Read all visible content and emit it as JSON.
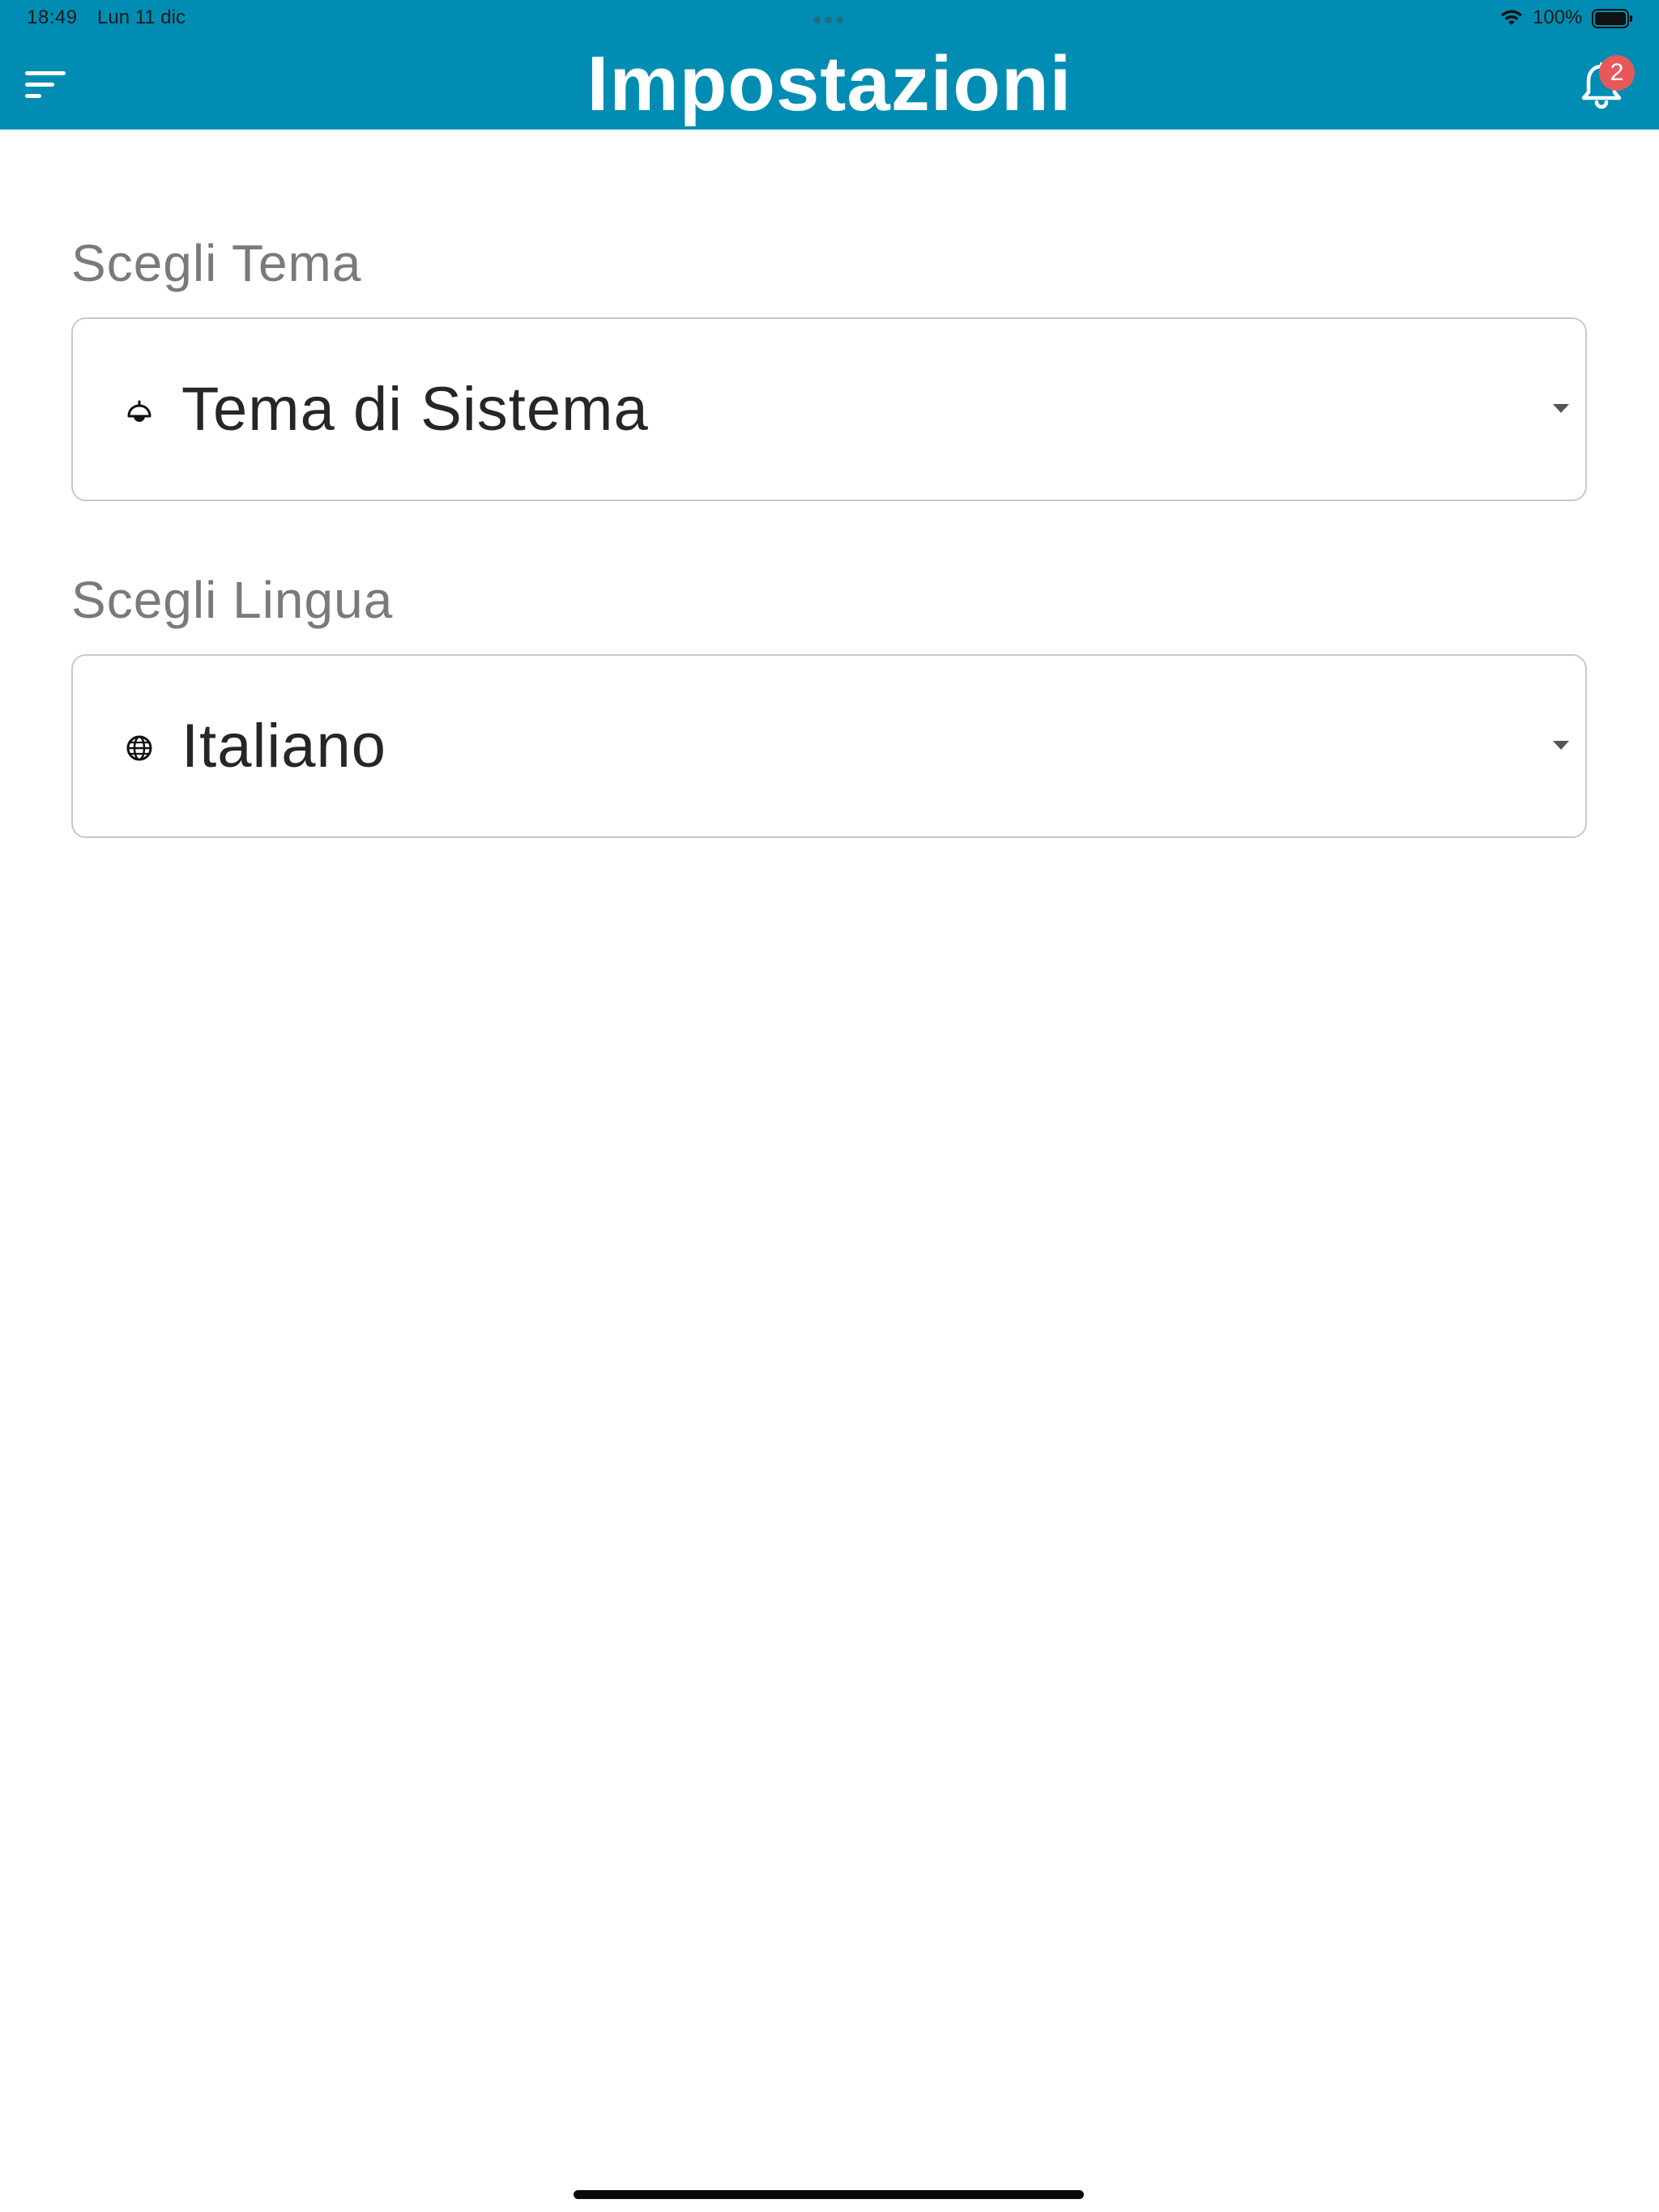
{
  "status_bar": {
    "time": "18:49",
    "date": "Lun 11 dic",
    "battery_percent": "100%",
    "wifi_icon": "wifi-icon",
    "battery_icon": "battery-full-icon",
    "battery_level": 1.0
  },
  "header": {
    "title": "Impostazioni",
    "menu_icon": "sort-lines-icon",
    "notifications_icon": "bell-icon",
    "notifications_count": "2",
    "background_color": "#018db3",
    "badge_color": "#e8585a"
  },
  "settings": {
    "theme": {
      "label": "Scegli Tema",
      "selected_value": "Tema di Sistema",
      "icon": "lamp-icon"
    },
    "language": {
      "label": "Scegli Lingua",
      "selected_value": "Italiano",
      "icon": "globe-icon"
    }
  }
}
